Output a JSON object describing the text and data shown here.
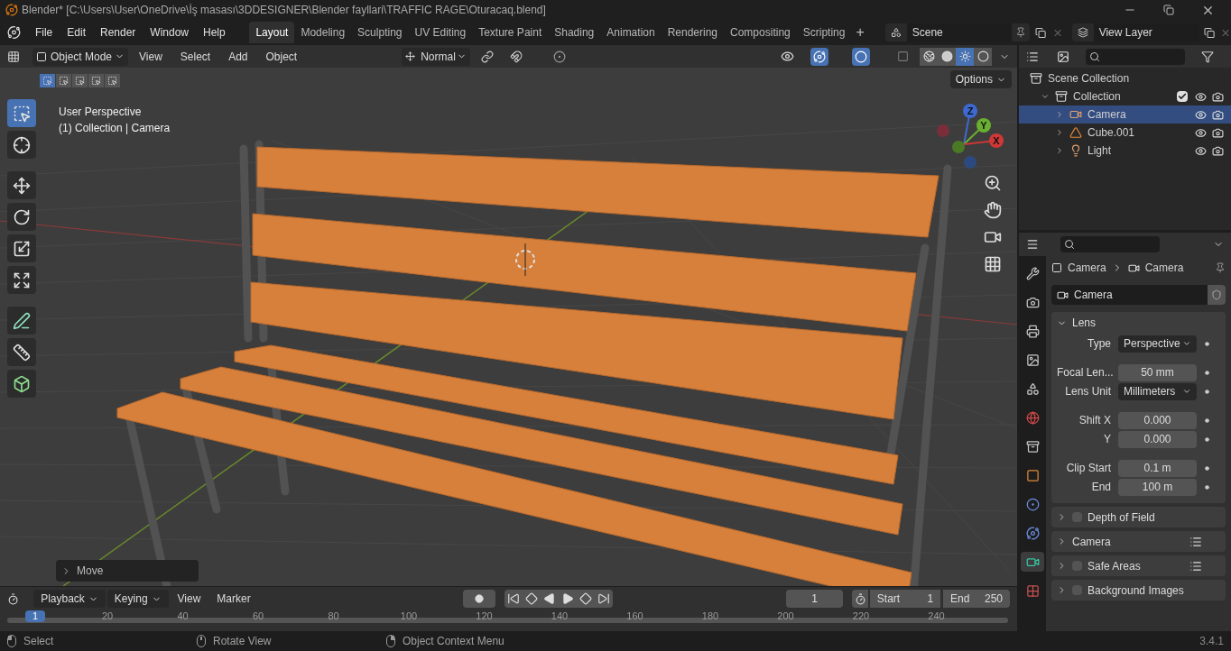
{
  "window": {
    "title": "Blender* [C:\\Users\\User\\OneDrive\\İş masası\\3DDESIGNER\\Blender fayllari\\TRAFFIC RAGE\\Oturacaq.blend]"
  },
  "menu": [
    "File",
    "Edit",
    "Render",
    "Window",
    "Help"
  ],
  "workspaces": [
    {
      "label": "Layout",
      "selected": true
    },
    {
      "label": "Modeling",
      "selected": false
    },
    {
      "label": "Sculpting",
      "selected": false
    },
    {
      "label": "UV Editing",
      "selected": false
    },
    {
      "label": "Texture Paint",
      "selected": false
    },
    {
      "label": "Shading",
      "selected": false
    },
    {
      "label": "Animation",
      "selected": false
    },
    {
      "label": "Rendering",
      "selected": false
    },
    {
      "label": "Compositing",
      "selected": false
    },
    {
      "label": "Scripting",
      "selected": false
    }
  ],
  "add_workspace": "+",
  "scene": "Scene",
  "view_layer": "View Layer",
  "viewport": {
    "mode": "Object Mode",
    "menus": [
      "View",
      "Select",
      "Add",
      "Object"
    ],
    "orientation": "Normal",
    "options": "Options",
    "show_gizmos": true,
    "show_overlays": true,
    "select_modes": [
      {
        "selected": true
      },
      {
        "selected": false
      },
      {
        "selected": false
      },
      {
        "selected": false
      },
      {
        "selected": false
      }
    ],
    "shading": [
      {
        "kind": "wireframe",
        "selected": false
      },
      {
        "kind": "solid",
        "selected": false
      },
      {
        "kind": "material",
        "selected": true
      },
      {
        "kind": "rendered",
        "selected": false
      }
    ],
    "info": [
      "User Perspective",
      "(1) Collection | Camera"
    ],
    "tools": [
      {
        "kind": "select",
        "selected": true
      },
      {
        "kind": "cursor",
        "selected": false
      },
      {
        "kind": "move",
        "selected": false
      },
      {
        "kind": "rotate",
        "selected": false
      },
      {
        "kind": "scale",
        "selected": false
      },
      {
        "kind": "transform",
        "selected": false
      },
      {
        "kind": "annotate",
        "selected": false
      },
      {
        "kind": "measure",
        "selected": false
      },
      {
        "kind": "add-cube",
        "selected": false
      }
    ],
    "axes": [
      "Z",
      "Y",
      "X"
    ],
    "last_operator": {
      "label": "Move",
      "expanded": false
    }
  },
  "timeline": {
    "menus": [
      "Playback",
      "Keying",
      "View",
      "Marker"
    ],
    "current_frame": "1",
    "start_label": "Start",
    "start": "1",
    "end_label": "End",
    "end": "250",
    "ruler_current": "1",
    "ruler_ticks": [
      "20",
      "40",
      "60",
      "80",
      "100",
      "120",
      "140",
      "160",
      "180",
      "200",
      "220",
      "240"
    ]
  },
  "status_bar": {
    "items": [
      {
        "kind": "left",
        "label": "Select"
      },
      {
        "kind": "middle",
        "label": "Rotate View"
      },
      {
        "kind": "right",
        "label": "Object Context Menu"
      }
    ],
    "version": "3.4.1"
  },
  "outliner": {
    "items": [
      {
        "kind": "scene",
        "label": "Scene Collection",
        "children": [
          {
            "kind": "collection",
            "label": "Collection",
            "expanded": true,
            "checked": true,
            "children": [
              {
                "kind": "camera",
                "label": "Camera",
                "selected": true,
                "expanded": false
              },
              {
                "kind": "mesh",
                "label": "Cube.001",
                "selected": false,
                "expanded": false
              },
              {
                "kind": "light",
                "label": "Light",
                "selected": false,
                "expanded": false
              }
            ]
          }
        ]
      }
    ]
  },
  "properties": {
    "breadcrumb": [
      "Camera",
      "Camera"
    ],
    "data_name": "Camera",
    "tabs": [
      {
        "kind": "tool",
        "selected": false
      },
      {
        "kind": "render",
        "selected": false
      },
      {
        "kind": "output",
        "selected": false
      },
      {
        "kind": "view-layer",
        "selected": false
      },
      {
        "kind": "scene",
        "selected": false
      },
      {
        "kind": "world",
        "selected": false
      },
      {
        "kind": "collection",
        "selected": false
      },
      {
        "kind": "object",
        "selected": false
      },
      {
        "kind": "physics",
        "selected": false
      },
      {
        "kind": "constraints",
        "selected": false
      },
      {
        "kind": "camera",
        "selected": true
      },
      {
        "kind": "texture",
        "selected": false
      }
    ],
    "lens": {
      "title": "Lens",
      "expanded": true,
      "groups": [
        [
          {
            "label": "Type",
            "value": "Perspective",
            "kind": "dropdown"
          }
        ],
        [
          {
            "label": "Focal Len...",
            "value": "50 mm",
            "kind": "number"
          },
          {
            "label": "Lens Unit",
            "value": "Millimeters",
            "kind": "dropdown"
          }
        ],
        [
          {
            "label": "Shift X",
            "value": "0.000",
            "kind": "number"
          },
          {
            "label": "Y",
            "value": "0.000",
            "kind": "number"
          }
        ],
        [
          {
            "label": "Clip Start",
            "value": "0.1 m",
            "kind": "number"
          },
          {
            "label": "End",
            "value": "100 m",
            "kind": "number"
          }
        ]
      ]
    },
    "panels": [
      {
        "title": "Depth of Field",
        "checkbox": true,
        "checked": false,
        "presets": false
      },
      {
        "title": "Camera",
        "checkbox": false,
        "presets": true
      },
      {
        "title": "Safe Areas",
        "checkbox": true,
        "checked": false,
        "presets": true
      },
      {
        "title": "Background Images",
        "checkbox": true,
        "checked": false,
        "presets": false
      }
    ]
  }
}
